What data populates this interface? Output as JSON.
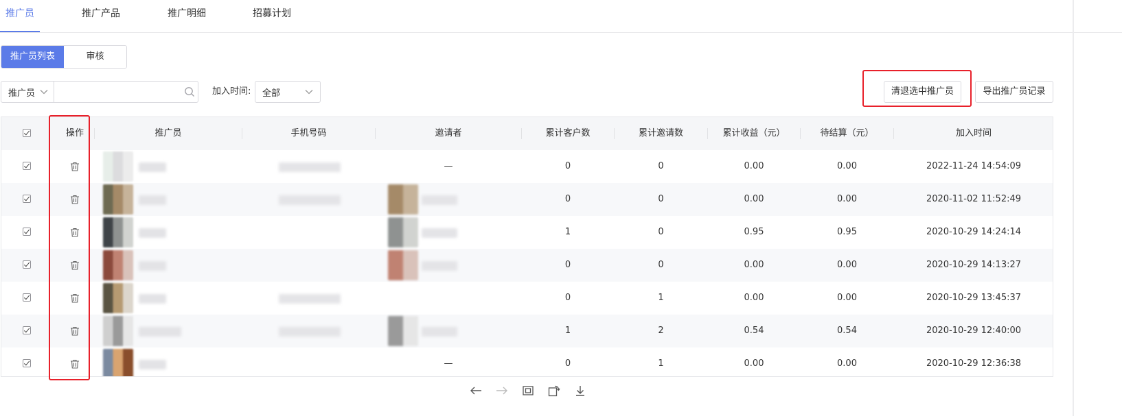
{
  "tabs": [
    {
      "label": "推广员",
      "active": true
    },
    {
      "label": "推广产品",
      "active": false
    },
    {
      "label": "推广明细",
      "active": false
    },
    {
      "label": "招募计划",
      "active": false
    }
  ],
  "segment": {
    "list_label": "推广员列表",
    "review_label": "审核"
  },
  "filters": {
    "search_type": "推广员",
    "search_value": "",
    "join_time_label": "加入时间:",
    "join_time_value": "全部"
  },
  "actions": {
    "clear_label": "清退选中推广员",
    "export_label": "导出推广员记录"
  },
  "table": {
    "columns": [
      "操作",
      "推广员",
      "手机号码",
      "邀请者",
      "累计客户数",
      "累计邀请数",
      "累计收益（元）",
      "待结算（元）",
      "加入时间"
    ],
    "rows": [
      {
        "inviter": "—",
        "customers": "0",
        "invites": "0",
        "earnings": "0.00",
        "pending": "0.00",
        "joined": "2022-11-24 14:54:09"
      },
      {
        "inviter": "",
        "customers": "0",
        "invites": "0",
        "earnings": "0.00",
        "pending": "0.00",
        "joined": "2020-11-02 11:52:49"
      },
      {
        "inviter": "",
        "customers": "1",
        "invites": "0",
        "earnings": "0.95",
        "pending": "0.95",
        "joined": "2020-10-29 14:24:14"
      },
      {
        "inviter": "",
        "customers": "0",
        "invites": "0",
        "earnings": "0.00",
        "pending": "0.00",
        "joined": "2020-10-29 14:13:27"
      },
      {
        "inviter": "",
        "customers": "0",
        "invites": "1",
        "earnings": "0.00",
        "pending": "0.00",
        "joined": "2020-10-29 13:45:37"
      },
      {
        "inviter": "",
        "customers": "1",
        "invites": "2",
        "earnings": "0.54",
        "pending": "0.54",
        "joined": "2020-10-29 12:40:00"
      },
      {
        "inviter": "—",
        "customers": "0",
        "invites": "1",
        "earnings": "0.00",
        "pending": "0.00",
        "joined": "2020-10-29 12:36:38"
      }
    ]
  },
  "colors": {
    "accent": "#5b7be8",
    "highlight": "#e8202a"
  },
  "icons": {
    "row_action": "trash-icon",
    "search": "search-icon",
    "viewer": [
      "arrow-left-icon",
      "arrow-right-icon",
      "fit-screen-icon",
      "rotate-icon",
      "download-icon"
    ]
  }
}
